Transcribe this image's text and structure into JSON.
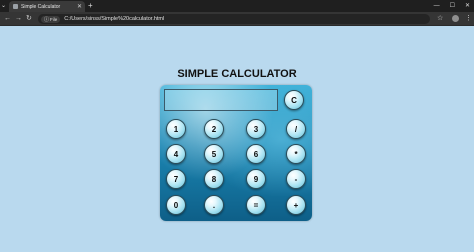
{
  "browser": {
    "tab_title": "Simple Calculator",
    "file_chip": "File",
    "url": "C:/Users/sinss/Simple%20calculator.html"
  },
  "page": {
    "title": "SIMPLE CALCULATOR"
  },
  "calculator": {
    "display_value": "",
    "clear_label": "C",
    "buttons": [
      "1",
      "2",
      "3",
      "/",
      "4",
      "5",
      "6",
      "*",
      "7",
      "8",
      "9",
      "-",
      "0",
      ".",
      "=",
      "+"
    ]
  }
}
